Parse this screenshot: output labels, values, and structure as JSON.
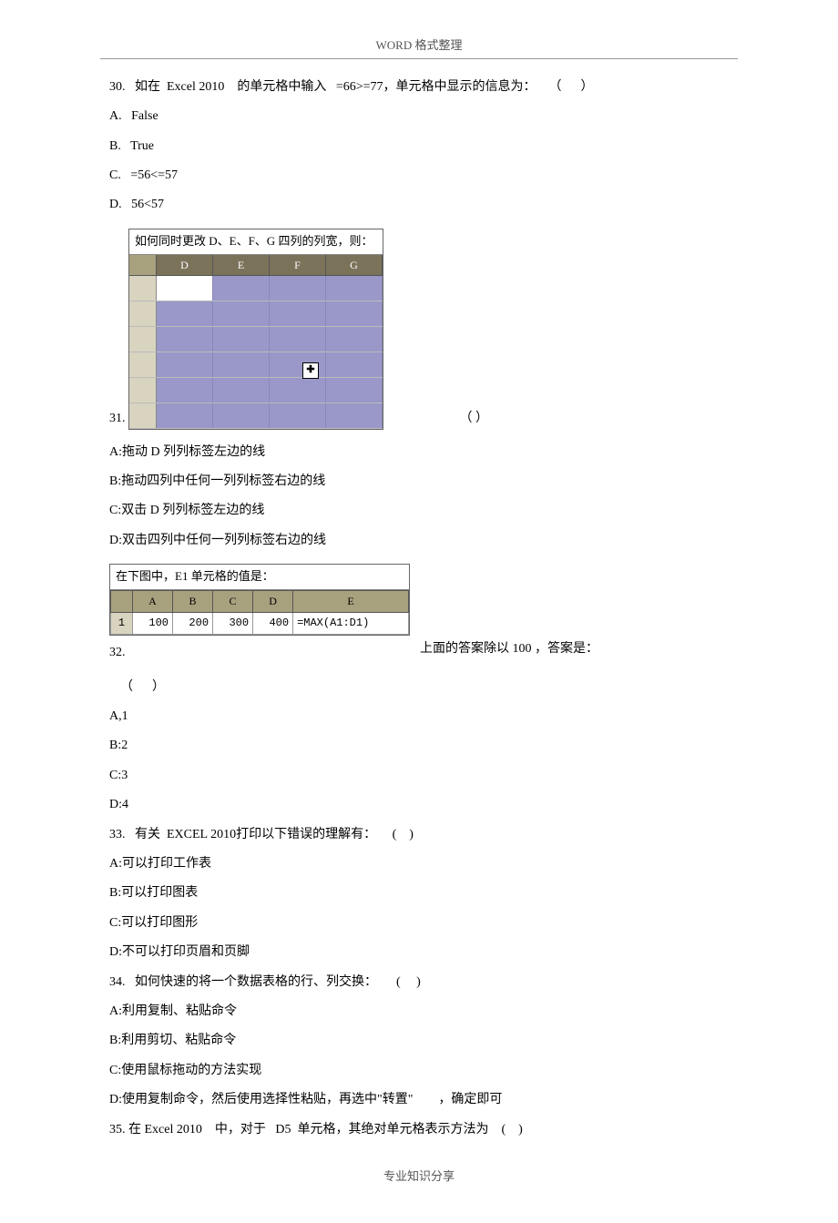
{
  "header": "WORD 格式整理",
  "footer": "专业知识分享",
  "q30": {
    "prompt": "30.   如在  Excel 2010    的单元格中输入   =66>=77，单元格中显示的信息为：    （      ）",
    "a": "A.   False",
    "b": "B.   True",
    "c": "C.   =56<=57",
    "d": "D.   56<57"
  },
  "excel1": {
    "title": "如何同时更改 D、E、F、G 四列的列宽，则：",
    "cols": [
      "D",
      "E",
      "F",
      "G"
    ]
  },
  "q31": {
    "num": "31.",
    "paren": "（      ）",
    "a": "A:拖动 D 列列标签左边的线",
    "b": "B:拖动四列中任何一列列标签右边的线",
    "c": "C:双击 D 列列标签左边的线",
    "d": "D:双击四列中任何一列列标签右边的线"
  },
  "chart_data": {
    "type": "table",
    "title": "在下图中，E1 单元格的值是：",
    "columns": [
      "A",
      "B",
      "C",
      "D",
      "E"
    ],
    "rows": [
      {
        "row": 1,
        "A": 100,
        "B": 200,
        "C": 300,
        "D": 400,
        "E": "=MAX(A1:D1)"
      }
    ]
  },
  "q32": {
    "num": "32.",
    "tail": "上面的答案除以      100 ，答案是：",
    "paren": "（      ）",
    "a": "A,1",
    "b": "B:2",
    "c": "C:3",
    "d": "D:4"
  },
  "q33": {
    "prompt": "33.   有关  EXCEL 2010打印以下错误的理解有：     (    )",
    "a": "A:可以打印工作表",
    "b": "B:可以打印图表",
    "c": "C:可以打印图形",
    "d": "D:不可以打印页眉和页脚"
  },
  "q34": {
    "prompt": "34.   如何快速的将一个数据表格的行、列交换：      (     )",
    "a": "A:利用复制、粘贴命令",
    "b": "B:利用剪切、粘贴命令",
    "c": "C:使用鼠标拖动的方法实现",
    "d": "D:使用复制命令，然后使用选择性粘贴，再选中\"转置\"        ，确定即可"
  },
  "q35": {
    "prompt": "35. 在 Excel 2010    中，对于   D5  单元格，其绝对单元格表示方法为    (    )"
  }
}
